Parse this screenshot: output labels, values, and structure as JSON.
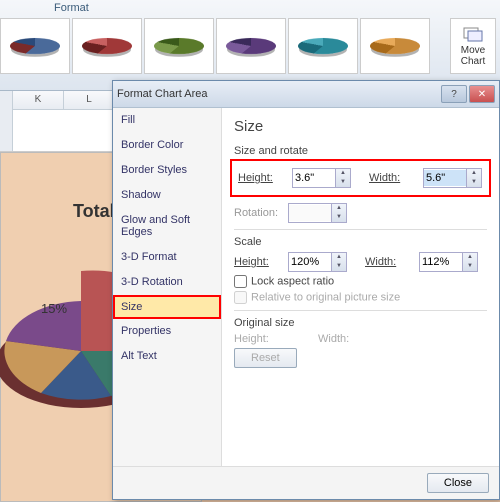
{
  "ribbon": {
    "tab": "Format",
    "move_chart": "Move\nChart"
  },
  "columns": [
    "K",
    "L"
  ],
  "chart": {
    "title": "Total",
    "slice_label": "15%"
  },
  "dialog": {
    "title": "Format Chart Area",
    "nav": [
      "Fill",
      "Border Color",
      "Border Styles",
      "Shadow",
      "Glow and Soft Edges",
      "3-D Format",
      "3-D Rotation",
      "Size",
      "Properties",
      "Alt Text"
    ],
    "heading": "Size",
    "grp_size_rotate": "Size and rotate",
    "height_label": "Height:",
    "width_label": "Width:",
    "rotation_label": "Rotation:",
    "height_val": "3.6\"",
    "width_val": "5.6\"",
    "grp_scale": "Scale",
    "scale_h_val": "120%",
    "scale_w_val": "112%",
    "cb_lock": "Lock aspect ratio",
    "cb_rel": "Relative to original picture size",
    "grp_orig": "Original size",
    "orig_h": "Height:",
    "orig_w": "Width:",
    "reset": "Reset",
    "close": "Close"
  }
}
